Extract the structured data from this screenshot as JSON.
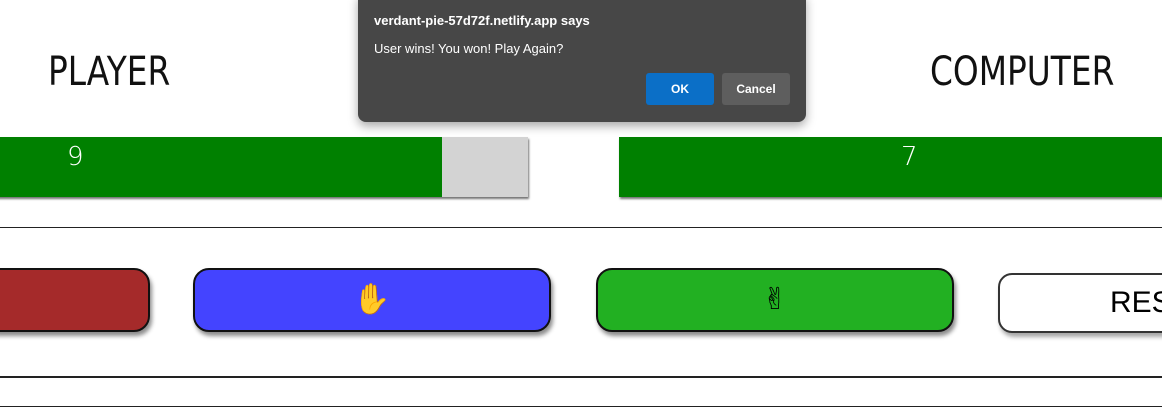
{
  "dialog": {
    "title": "verdant-pie-57d72f.netlify.app says",
    "message": "User wins! You won! Play Again?",
    "ok_label": "OK",
    "cancel_label": "Cancel"
  },
  "scoreboard": {
    "player_label": "PLAYER",
    "computer_label": "COMPUTER",
    "player_score": "9",
    "computer_score": "7",
    "player_bar_fill_fraction": 0.84,
    "computer_bar_fill_fraction": 1.0,
    "bar_fill_color": "#008000",
    "bar_track_color": "#d3d3d3"
  },
  "choices": {
    "rock": {
      "icon": "rock-hand-icon",
      "glyph": "",
      "color": "#a52a2a"
    },
    "paper": {
      "icon": "raised-hand-icon",
      "glyph": "✋",
      "color": "#4444ff"
    },
    "scissors": {
      "icon": "victory-hand-icon",
      "glyph": "✌",
      "color": "#22b022"
    },
    "reset_label": "RES"
  }
}
